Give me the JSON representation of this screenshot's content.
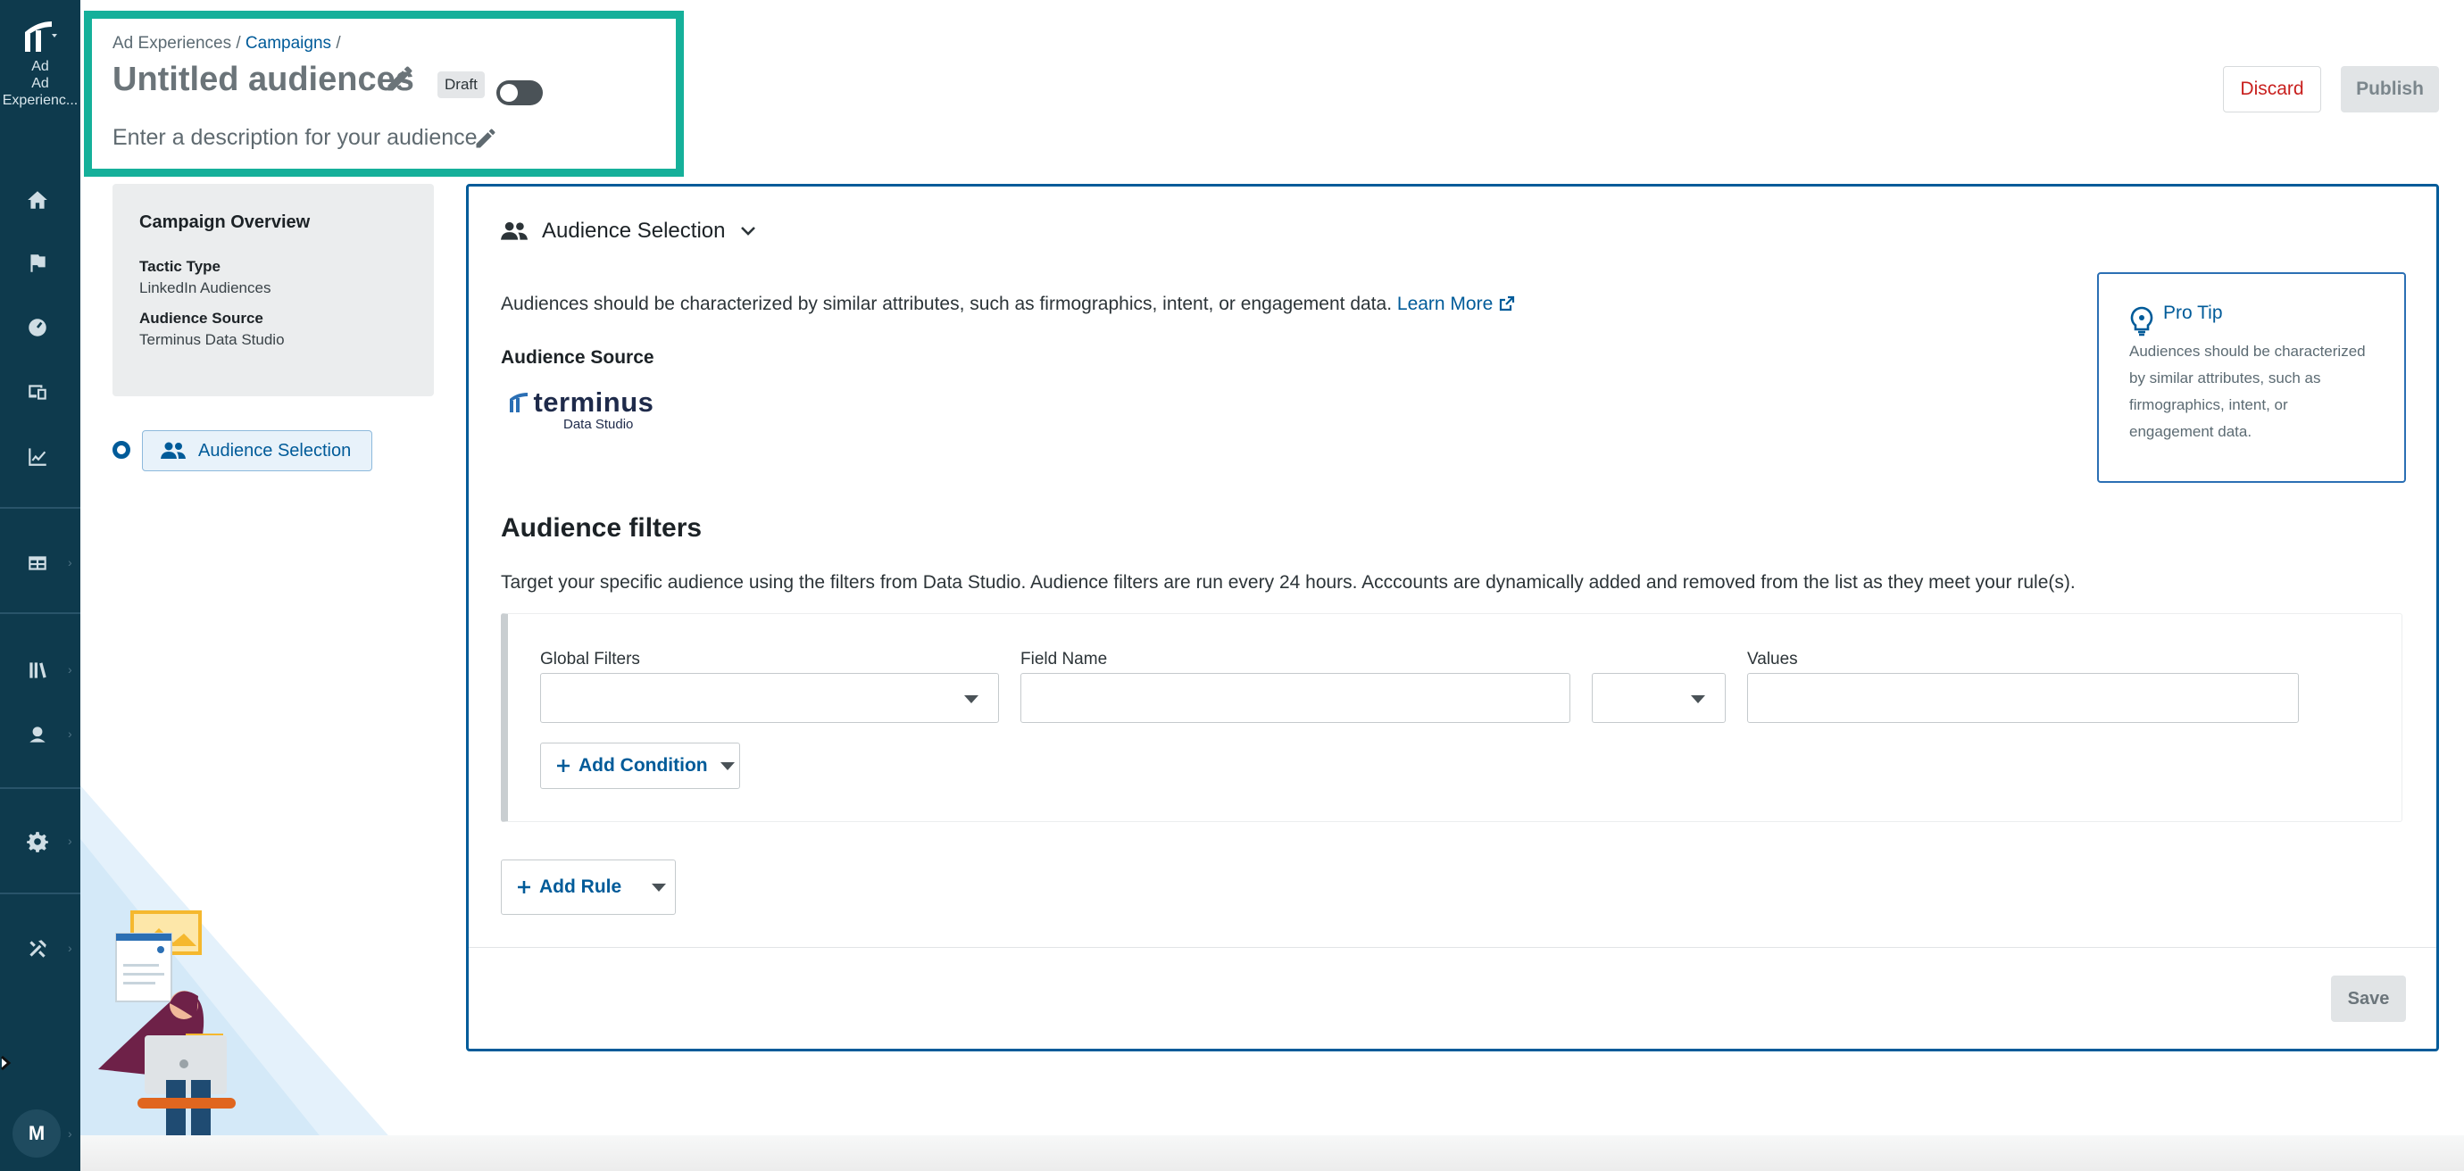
{
  "app": {
    "name": "Ad Experiences",
    "name_short": "Ad Experienc...",
    "logo_icon": "terminus-logo-icon"
  },
  "nav": {
    "items": [
      {
        "name": "home",
        "icon": "home-icon"
      },
      {
        "name": "flag",
        "icon": "flag-icon"
      },
      {
        "name": "gauge",
        "icon": "gauge-icon"
      },
      {
        "name": "devices",
        "icon": "devices-icon"
      },
      {
        "name": "analytics",
        "icon": "chart-line-icon"
      },
      {
        "name": "table",
        "icon": "table-icon"
      },
      {
        "name": "library",
        "icon": "library-icon"
      },
      {
        "name": "contact",
        "icon": "contact-icon"
      },
      {
        "name": "settings",
        "icon": "gear-icon"
      },
      {
        "name": "tools",
        "icon": "tools-icon"
      }
    ],
    "avatar_initial": "M"
  },
  "header": {
    "breadcrumb_root": "Ad Experiences",
    "breadcrumb_sep": "/",
    "breadcrumb_link": "Campaigns",
    "breadcrumb_trail": "/",
    "title": "Untitled audiences",
    "status_badge": "Draft",
    "description_placeholder": "Enter a description for your audience",
    "discard_label": "Discard",
    "publish_label": "Publish"
  },
  "overview": {
    "title": "Campaign Overview",
    "tactic_label": "Tactic Type",
    "tactic_value": "LinkedIn Audiences",
    "source_label": "Audience Source",
    "source_value": "Terminus Data Studio"
  },
  "steps": [
    {
      "label": "Audience Selection",
      "active": true
    }
  ],
  "main": {
    "section_title": "Audience Selection",
    "section_desc": "Audiences should be characterized by similar attributes, such as firmographics, intent, or engagement data.",
    "learn_more": "Learn More",
    "source_heading": "Audience Source",
    "source_logo_word": "terminus",
    "source_logo_sub": "Data Studio",
    "protip_title": "Pro Tip",
    "protip_body": "Audiences should be characterized by similar attributes, such as firmographics, intent, or engagement data.",
    "filters_heading": "Audience filters",
    "filters_desc": "Target your specific audience using the filters from Data Studio. Audience filters are run every 24 hours. Acccounts are dynamically added and removed from the list as they meet your rule(s).",
    "global_filters_label": "Global Filters",
    "field_name_label": "Field Name",
    "values_label": "Values",
    "global_filters_value": "",
    "field_name_value": "",
    "operator_value": "",
    "values_value": "",
    "add_condition_label": "Add Condition",
    "add_rule_label": "Add Rule",
    "save_label": "Save"
  },
  "colors": {
    "rail": "#0e3a4d",
    "accent": "#005b99",
    "highlight_border": "#15b09a",
    "danger": "#c8201e"
  }
}
